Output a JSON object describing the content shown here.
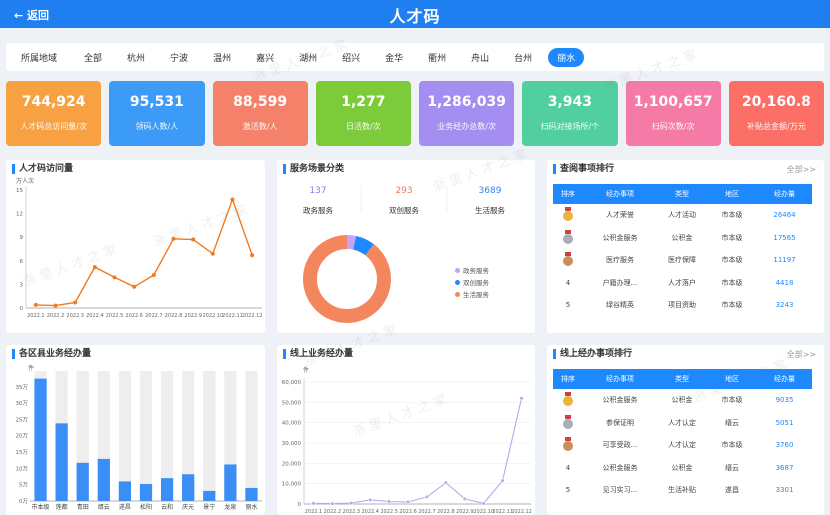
{
  "header": {
    "back_label": "← 返回",
    "title": "人才码"
  },
  "filter": {
    "label": "所属地域",
    "items": [
      "全部",
      "杭州",
      "宁波",
      "温州",
      "嘉兴",
      "湖州",
      "绍兴",
      "金华",
      "衢州",
      "舟山",
      "台州",
      "丽水"
    ],
    "active": "丽水"
  },
  "cards": [
    {
      "value": "744,924",
      "label": "人才码总访问量/次",
      "color": "#f7a142"
    },
    {
      "value": "95,531",
      "label": "领码人数/人",
      "color": "#3c9bf6"
    },
    {
      "value": "88,599",
      "label": "激活数/人",
      "color": "#f4826a"
    },
    {
      "value": "1,277",
      "label": "日活数/次",
      "color": "#7ccb3a"
    },
    {
      "value": "1,286,039",
      "label": "业务经办总数/次",
      "color": "#a58ef2"
    },
    {
      "value": "3,943",
      "label": "扫码对接场所/个",
      "color": "#52cfa0"
    },
    {
      "value": "1,100,657",
      "label": "扫码次数/次",
      "color": "#f67aa6"
    },
    {
      "value": "20,160.8",
      "label": "补贴总金额/万元",
      "color": "#fb6f67"
    }
  ],
  "visits": {
    "title": "人才码访问量",
    "unit": "万人次",
    "chart_data": {
      "type": "line",
      "x": [
        "2022.1",
        "2022.2",
        "2022.3",
        "2022.4",
        "2022.5",
        "2022.6",
        "2022.7",
        "2022.8",
        "2022.9",
        "2022.10",
        "2022.11",
        "2022.12"
      ],
      "values": [
        0.4,
        0.3,
        0.7,
        5.2,
        3.9,
        2.7,
        4.2,
        8.8,
        8.7,
        6.9,
        13.8,
        6.7
      ],
      "ylim": [
        0,
        15
      ],
      "yticks": [
        0,
        3,
        6,
        9,
        12,
        15
      ],
      "color": "#f07b20"
    }
  },
  "scene": {
    "title": "服务场景分类",
    "stats": [
      {
        "value": "137",
        "label": "政务服务",
        "color": "#8b7bf6"
      },
      {
        "value": "293",
        "label": "双创服务",
        "color": "#ef7d5b"
      },
      {
        "value": "3689",
        "label": "生活服务",
        "color": "#2f86f5"
      }
    ],
    "chart_data": {
      "type": "pie",
      "labels": [
        "政务服务",
        "双创服务",
        "生活服务"
      ],
      "values": [
        137,
        293,
        3689
      ],
      "colors": [
        "#c4a4f4",
        "#1e88ff",
        "#f4865e"
      ]
    }
  },
  "review": {
    "title": "查阅事项排行",
    "more": "全部>>",
    "columns": [
      "排序",
      "经办事项",
      "类型",
      "地区",
      "经办量"
    ],
    "rows": [
      [
        "1",
        "人才荣誉",
        "人才活动",
        "市本级",
        "26464"
      ],
      [
        "2",
        "公积金服务",
        "公积金",
        "市本级",
        "17565"
      ],
      [
        "3",
        "医疗服务",
        "医疗保障",
        "市本级",
        "11197"
      ],
      [
        "4",
        "户籍办理...",
        "人才落户",
        "市本级",
        "4418"
      ],
      [
        "5",
        "绿谷精英",
        "项目资助",
        "市本级",
        "3243"
      ]
    ]
  },
  "county": {
    "title": "各区县业务经办量",
    "unit": "件",
    "chart_data": {
      "type": "bar",
      "categories": [
        "市本级",
        "莲都",
        "青田",
        "缙云",
        "遂昌",
        "松阳",
        "云和",
        "庆元",
        "景宁",
        "龙泉",
        "丽水"
      ],
      "values": [
        375000,
        238000,
        117000,
        129000,
        60000,
        52000,
        70000,
        82000,
        31000,
        112000,
        40000
      ],
      "ylim": [
        0,
        380000
      ],
      "yticks": [
        "0万",
        "5万",
        "10万",
        "15万",
        "20万",
        "25万",
        "30万",
        "35万"
      ],
      "color": "#3c8ef7",
      "bg_color": "#eeeeee"
    }
  },
  "online": {
    "title": "线上业务经办量",
    "unit": "件",
    "chart_data": {
      "type": "line",
      "x": [
        "2022.1",
        "2022.2",
        "2022.3",
        "2022.4",
        "2022.5",
        "2022.6",
        "2022.7",
        "2022.8",
        "2022.9",
        "2022.10",
        "2022.11",
        "2022.12"
      ],
      "values": [
        300,
        200,
        500,
        2000,
        1200,
        1000,
        3500,
        10500,
        2500,
        300,
        11500,
        52000
      ],
      "ylim": [
        0,
        60000
      ],
      "yticks": [
        "0",
        "10,000",
        "20,000",
        "30,000",
        "40,000",
        "50,000",
        "60,000"
      ],
      "color": "#b9a6ef"
    }
  },
  "online_rank": {
    "title": "线上经办事项排行",
    "more": "全部>>",
    "columns": [
      "排序",
      "经办事项",
      "类型",
      "地区",
      "经办量"
    ],
    "rows": [
      [
        "1",
        "公积金服务",
        "公积金",
        "市本级",
        "9035"
      ],
      [
        "2",
        "参保证明",
        "人才认定",
        "缙云",
        "5051"
      ],
      [
        "3",
        "可享受政...",
        "人才认定",
        "市本级",
        "3760"
      ],
      [
        "4",
        "公积金服务",
        "公积金",
        "缙云",
        "3687"
      ],
      [
        "5",
        "见习实习...",
        "生活补贴",
        "遂昌",
        "3301"
      ]
    ]
  },
  "medal_colors": [
    "#e8b63b",
    "#a7aeb8",
    "#c98f5a"
  ]
}
